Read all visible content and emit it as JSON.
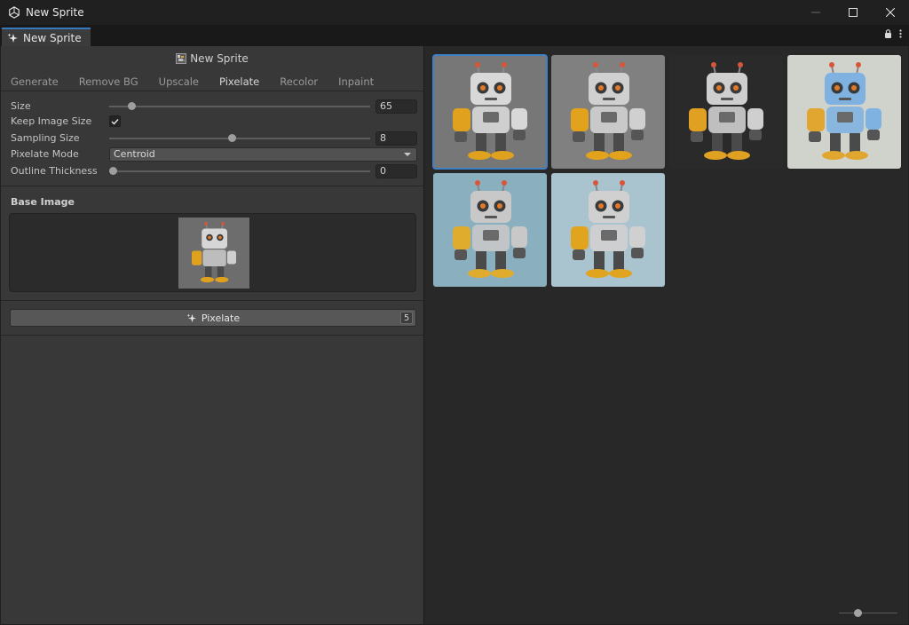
{
  "window": {
    "title": "New Sprite"
  },
  "tab": {
    "label": "New Sprite"
  },
  "panel": {
    "header": "New Sprite",
    "subtabs": [
      "Generate",
      "Remove BG",
      "Upscale",
      "Pixelate",
      "Recolor",
      "Inpaint"
    ],
    "active_subtab": "Pixelate"
  },
  "settings": {
    "size": {
      "label": "Size",
      "value": "65",
      "slider_fraction": 0.075
    },
    "keep_image_size": {
      "label": "Keep Image Size",
      "checked": true
    },
    "sampling_size": {
      "label": "Sampling Size",
      "value": "8",
      "slider_fraction": 0.47
    },
    "pixelate_mode": {
      "label": "Pixelate Mode",
      "value": "Centroid"
    },
    "outline_thickness": {
      "label": "Outline Thickness",
      "value": "0",
      "slider_fraction": 0.0
    }
  },
  "base_image": {
    "title": "Base Image"
  },
  "action": {
    "label": "Pixelate",
    "badge": "5"
  },
  "gallery": {
    "items": [
      {
        "bg": "#777777",
        "body": "#d8d8d8",
        "accent": "#e0a21e",
        "selected": true
      },
      {
        "bg": "#808080",
        "body": "#d0d0d0",
        "accent": "#e3a21c",
        "selected": false
      },
      {
        "bg": "#2a2a2a",
        "body": "#cfcfcf",
        "accent": "#e0a022",
        "selected": false
      },
      {
        "bg": "#cfd3cc",
        "body": "#7fb2e0",
        "accent": "#e0a630",
        "selected": false
      },
      {
        "bg": "#8ab0c0",
        "body": "#c8c8c8",
        "accent": "#e0ac2e",
        "selected": false
      },
      {
        "bg": "#a9c3cf",
        "body": "#d0d0d0",
        "accent": "#e0a41e",
        "selected": false
      }
    ]
  },
  "zoom": {
    "fraction": 0.3
  }
}
